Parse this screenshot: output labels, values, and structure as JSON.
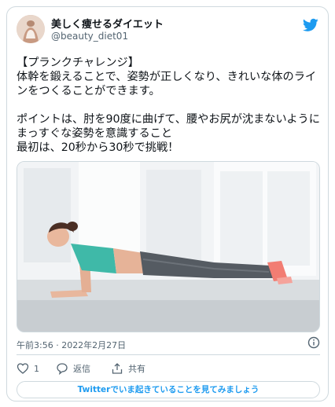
{
  "user": {
    "display_name": "美しく痩せるダイエット",
    "handle": "@beauty_diet01",
    "avatar_icon": "avatar-photo"
  },
  "tweet": {
    "text": "【プランクチャレンジ】\n体幹を鍛えることで、姿勢が正しくなり、きれいな体のラインをつくることができます。\n\nポイントは、肘を90度に曲げて、腰やお尻が沈まないようにまっすぐな姿勢を意識すること\n最初は、20秒から30秒で挑戦！",
    "image_icon": "plank-exercise-photo",
    "timestamp": "午前3:56 · 2022年2月27日"
  },
  "actions": {
    "like_count": "1",
    "reply_label": "返信",
    "share_label": "共有"
  },
  "cta": {
    "label": "Twitterでいま起きていることを見てみましょう"
  },
  "colors": {
    "accent": "#1d9bf0",
    "text": "#0f1419",
    "secondary": "#536471",
    "border": "#cfd9de"
  }
}
